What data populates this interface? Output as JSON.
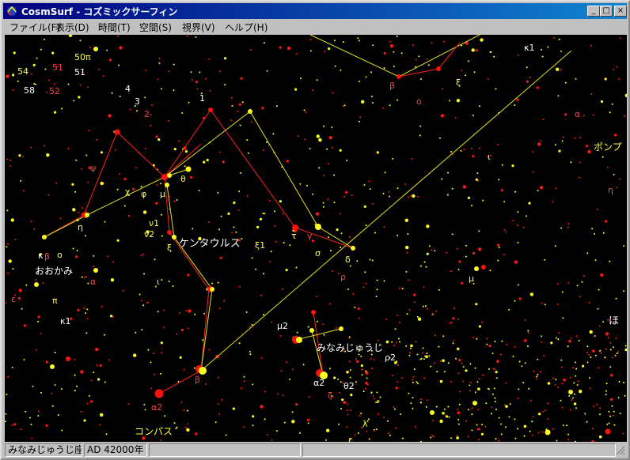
{
  "window": {
    "title": "CosmSurf - コズミックサーフィン",
    "minimize": "_",
    "maximize": "□",
    "close": "×"
  },
  "menu": [
    {
      "label": "ファイル(F)"
    },
    {
      "label": "表示(D)"
    },
    {
      "label": "時間(T)"
    },
    {
      "label": "空間(S)"
    },
    {
      "label": "視界(V)"
    },
    {
      "label": "ヘルプ(H)"
    }
  ],
  "status": {
    "constellation": "みなみじゅうじ座付",
    "date": "AD 42000年",
    "pane3": "",
    "pane4": ""
  },
  "sky": {
    "constellation_labels": [
      {
        "text": "ケンタウルス"
      },
      {
        "text": "おおかみ"
      },
      {
        "text": "みなみじゅうじ"
      },
      {
        "text": "コンパス"
      },
      {
        "text": "ポンプ"
      },
      {
        "text": "ほ"
      }
    ],
    "star_labels": [
      {
        "text": "50π"
      },
      {
        "text": "51"
      },
      {
        "text": "54"
      },
      {
        "text": "51"
      },
      {
        "text": "58"
      },
      {
        "text": "52"
      },
      {
        "text": "4"
      },
      {
        "text": "3"
      },
      {
        "text": "2"
      },
      {
        "text": "1"
      },
      {
        "text": "θ"
      },
      {
        "text": "ψ"
      },
      {
        "text": "χ"
      },
      {
        "text": "φ"
      },
      {
        "text": "μ"
      },
      {
        "text": "η"
      },
      {
        "text": "κ"
      },
      {
        "text": "β"
      },
      {
        "text": "ο"
      },
      {
        "text": "ν1"
      },
      {
        "text": "ν2"
      },
      {
        "text": "ξ"
      },
      {
        "text": "ε"
      },
      {
        "text": "ι"
      },
      {
        "text": "γ"
      },
      {
        "text": "τ"
      },
      {
        "text": "σ"
      },
      {
        "text": "δ"
      },
      {
        "text": "ρ"
      },
      {
        "text": "α"
      },
      {
        "text": "ξ1"
      },
      {
        "text": "μ2"
      },
      {
        "text": "α2"
      },
      {
        "text": "β"
      },
      {
        "text": "α2"
      },
      {
        "text": "θ2"
      },
      {
        "text": "ρ2"
      },
      {
        "text": "κ1"
      },
      {
        "text": "π"
      },
      {
        "text": "β"
      },
      {
        "text": "ο"
      },
      {
        "text": "ξ"
      },
      {
        "text": "κ1"
      },
      {
        "text": "α"
      },
      {
        "text": "ι"
      },
      {
        "text": "η"
      },
      {
        "text": "μ"
      },
      {
        "text": "ζ"
      },
      {
        "text": "ε"
      },
      {
        "text": "λ"
      }
    ]
  },
  "colors": {
    "sky": "#000000",
    "red_star": "#ff1010",
    "yellow_star": "#ffff20",
    "label_red": "#ff4040",
    "label_yellow": "#ffff40",
    "line_red": "#ff2020",
    "line_yellow": "#e8e820",
    "title_bar": "#000080"
  }
}
